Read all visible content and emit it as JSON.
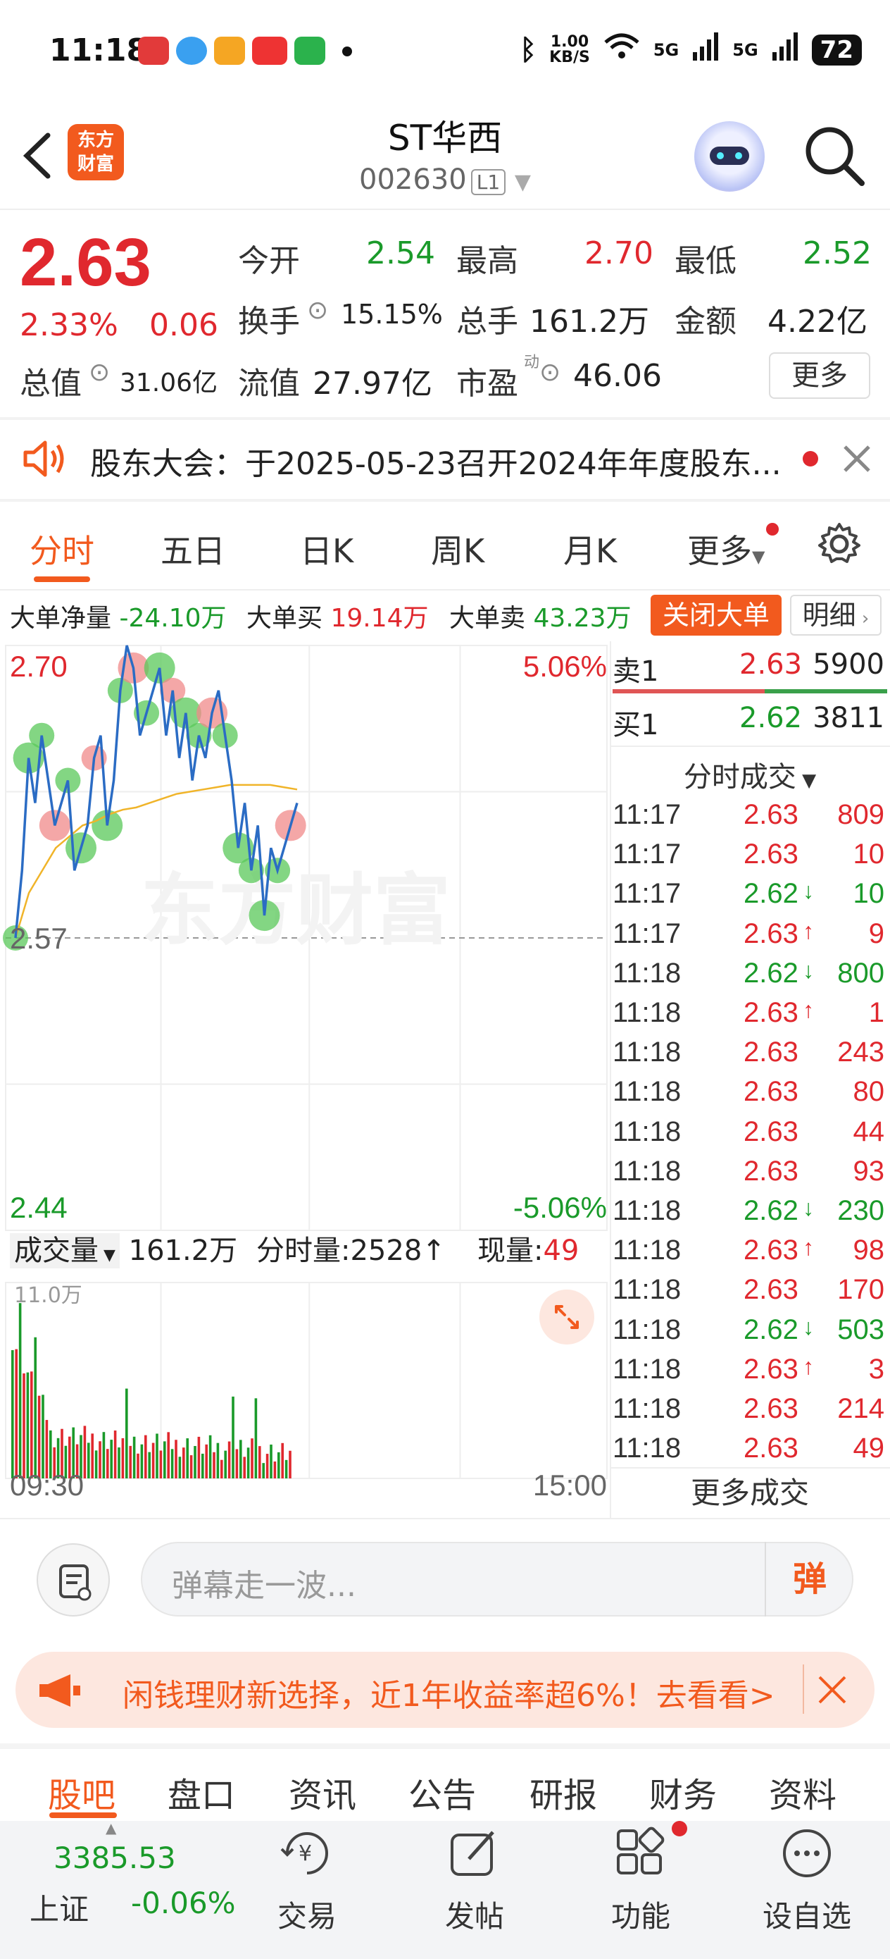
{
  "status_bar": {
    "time": "11:18",
    "net_speed_value": "1.00",
    "net_speed_unit": "KB/S",
    "signal_1": "5G",
    "signal_2": "5G",
    "battery": "72"
  },
  "header": {
    "back_icon": "chevron-left-icon",
    "logo_text": "东方财富",
    "stock_name": "ST华西",
    "stock_code": "002630",
    "level_tag": "L1"
  },
  "quote": {
    "price": "2.63",
    "change_pct": "2.33%",
    "change_abs": "0.06",
    "fields": [
      {
        "label": "今开",
        "value": "2.54",
        "color": "green"
      },
      {
        "label": "最高",
        "value": "2.70",
        "color": "red"
      },
      {
        "label": "最低",
        "value": "2.52",
        "color": "green"
      },
      {
        "label": "换手",
        "value": "15.15%",
        "color": "black"
      },
      {
        "label": "总手",
        "value": "161.2万",
        "color": "black"
      },
      {
        "label": "金额",
        "value": "4.22亿",
        "color": "black"
      },
      {
        "label": "总值",
        "value": "31.06亿",
        "color": "black"
      },
      {
        "label": "流值",
        "value": "27.97亿",
        "color": "black"
      },
      {
        "label": "市盈",
        "value": "46.06",
        "color": "black"
      }
    ],
    "pe_sup": "动",
    "more_label": "更多"
  },
  "notice": {
    "text": "股东大会：于2025-05-23召开2024年年度股东..."
  },
  "tabs": [
    "分时",
    "五日",
    "日K",
    "周K",
    "月K",
    "更多"
  ],
  "big_order": {
    "net_label": "大单净量",
    "net_value": "-24.10万",
    "buy_label": "大单买",
    "buy_value": "19.14万",
    "sell_label": "大单卖",
    "sell_value": "43.23万",
    "close_label": "关闭大单",
    "detail_label": "明细"
  },
  "chart": {
    "price_high": "2.70",
    "pct_high": "5.06%",
    "price_mid": "2.57",
    "price_low": "2.44",
    "pct_low": "-5.06%",
    "watermark": "东方财富",
    "volume_label": "成交量",
    "volume_total": "161.2万",
    "period_volume_label": "分时量:",
    "period_volume_value": "2528",
    "current_volume_label": "现量:",
    "current_volume_value": "49",
    "volume_axis_max": "11.0万",
    "time_start": "09:30",
    "time_end": "15:00"
  },
  "chart_data": {
    "type": "line",
    "ylim": [
      2.44,
      2.7
    ],
    "prev_close": 2.57,
    "price_line": [
      2.57,
      2.6,
      2.65,
      2.63,
      2.66,
      2.64,
      2.62,
      2.63,
      2.64,
      2.6,
      2.61,
      2.62,
      2.65,
      2.66,
      2.62,
      2.64,
      2.68,
      2.7,
      2.69,
      2.66,
      2.67,
      2.68,
      2.69,
      2.66,
      2.68,
      2.65,
      2.67,
      2.64,
      2.66,
      2.65,
      2.67,
      2.68,
      2.66,
      2.64,
      2.61,
      2.63,
      2.6,
      2.62,
      2.58,
      2.61,
      2.6,
      2.61,
      2.62,
      2.63
    ],
    "avg_line": [
      2.57,
      2.59,
      2.6,
      2.61,
      2.615,
      2.62,
      2.622,
      2.625,
      2.627,
      2.628,
      2.63,
      2.632,
      2.634,
      2.635,
      2.636,
      2.637,
      2.638,
      2.638,
      2.638,
      2.638,
      2.637,
      2.636
    ]
  },
  "orderbook": {
    "sell": {
      "label": "卖1",
      "price": "2.63",
      "vol": "5900"
    },
    "buy": {
      "label": "买1",
      "price": "2.62",
      "vol": "3811"
    },
    "trades_title": "分时成交",
    "more_trades": "更多成交"
  },
  "trades": [
    {
      "time": "11:17",
      "price": "2.63",
      "dir": "",
      "vol": "809",
      "color": "red"
    },
    {
      "time": "11:17",
      "price": "2.63",
      "dir": "",
      "vol": "10",
      "color": "red"
    },
    {
      "time": "11:17",
      "price": "2.62",
      "dir": "↓",
      "vol": "10",
      "color": "green"
    },
    {
      "time": "11:17",
      "price": "2.63",
      "dir": "↑",
      "vol": "9",
      "color": "red"
    },
    {
      "time": "11:18",
      "price": "2.62",
      "dir": "↓",
      "vol": "800",
      "color": "green"
    },
    {
      "time": "11:18",
      "price": "2.63",
      "dir": "↑",
      "vol": "1",
      "color": "red"
    },
    {
      "time": "11:18",
      "price": "2.63",
      "dir": "",
      "vol": "243",
      "color": "red"
    },
    {
      "time": "11:18",
      "price": "2.63",
      "dir": "",
      "vol": "80",
      "color": "red"
    },
    {
      "time": "11:18",
      "price": "2.63",
      "dir": "",
      "vol": "44",
      "color": "red"
    },
    {
      "time": "11:18",
      "price": "2.63",
      "dir": "",
      "vol": "93",
      "color": "red"
    },
    {
      "time": "11:18",
      "price": "2.62",
      "dir": "↓",
      "vol": "230",
      "color": "green"
    },
    {
      "time": "11:18",
      "price": "2.63",
      "dir": "↑",
      "vol": "98",
      "color": "red"
    },
    {
      "time": "11:18",
      "price": "2.63",
      "dir": "",
      "vol": "170",
      "color": "red"
    },
    {
      "time": "11:18",
      "price": "2.62",
      "dir": "↓",
      "vol": "503",
      "color": "green"
    },
    {
      "time": "11:18",
      "price": "2.63",
      "dir": "↑",
      "vol": "3",
      "color": "red"
    },
    {
      "time": "11:18",
      "price": "2.63",
      "dir": "",
      "vol": "214",
      "color": "red"
    },
    {
      "time": "11:18",
      "price": "2.63",
      "dir": "",
      "vol": "49",
      "color": "red"
    }
  ],
  "danmaku": {
    "placeholder": "弹幕走一波...",
    "send_label": "弹"
  },
  "ad": {
    "text": "闲钱理财新选择，近1年收益率超6%！去看看>"
  },
  "bottom_tabs": [
    "股吧",
    "盘口",
    "资讯",
    "公告",
    "研报",
    "财务",
    "资料"
  ],
  "bottom_nav": {
    "index_value": "3385.53",
    "index_name": "上证",
    "index_change": "-0.06%",
    "items": [
      "交易",
      "发帖",
      "功能",
      "设自选"
    ]
  },
  "colors": {
    "accent": "#f25a1e",
    "up": "#e0282e",
    "down": "#1a9a2a",
    "price_line": "#2b6cc4",
    "avg_line": "#f0b429"
  }
}
